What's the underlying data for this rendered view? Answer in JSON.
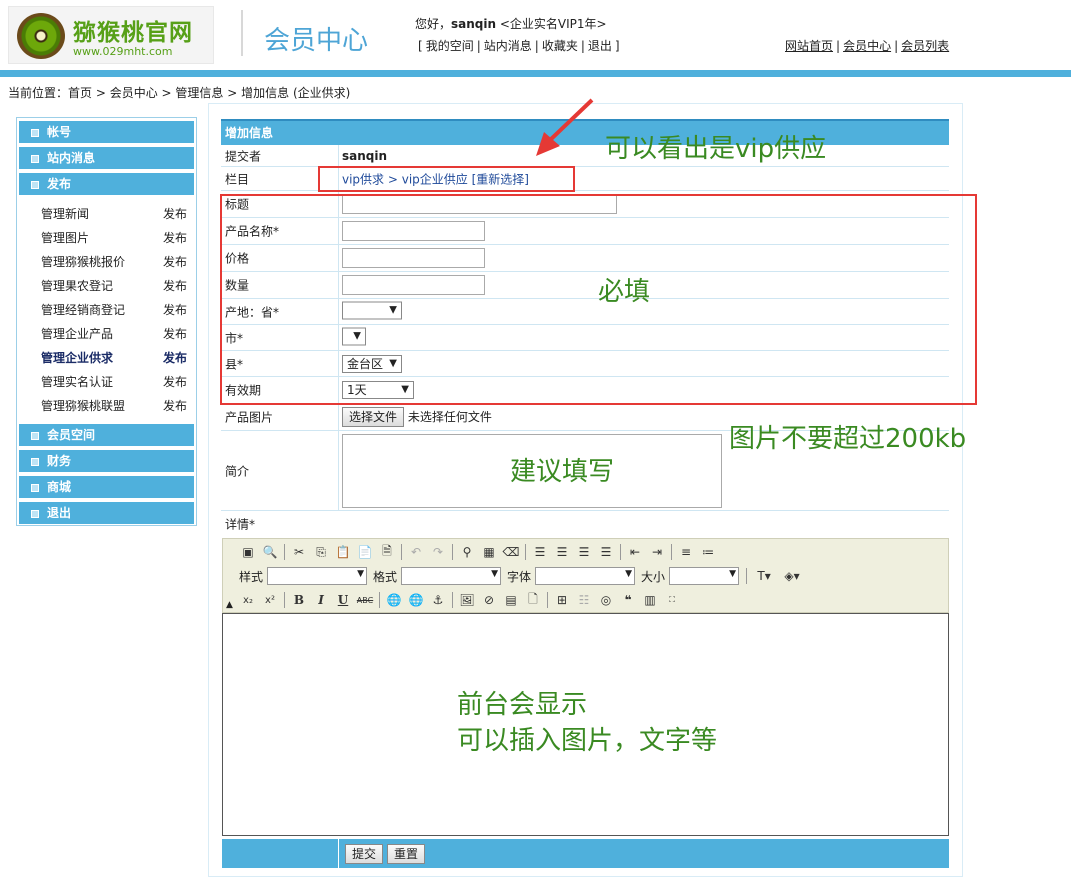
{
  "header": {
    "logo_title": "猕猴桃官网",
    "logo_url": "www.029mht.com",
    "center_title": "会员中心",
    "greeting_prefix": "您好，",
    "username": "sanqin",
    "member_level": "<企业实名VIP1年>",
    "quick_links": [
      "我的空间",
      "站内消息",
      "收藏夹",
      "退出"
    ],
    "site_links": [
      "网站首页",
      "会员中心",
      "会员列表"
    ]
  },
  "breadcrumb": {
    "prefix": "当前位置：",
    "items": [
      "首页",
      "会员中心",
      "管理信息",
      "增加信息 (企业供求)"
    ]
  },
  "sidebar": {
    "sections": [
      "帐号",
      "站内消息",
      "发布"
    ],
    "items": [
      {
        "label": "管理新闻",
        "action": "发布"
      },
      {
        "label": "管理图片",
        "action": "发布"
      },
      {
        "label": "管理猕猴桃报价",
        "action": "发布"
      },
      {
        "label": "管理果农登记",
        "action": "发布"
      },
      {
        "label": "管理经销商登记",
        "action": "发布"
      },
      {
        "label": "管理企业产品",
        "action": "发布"
      },
      {
        "label": "管理企业供求",
        "action": "发布"
      },
      {
        "label": "管理实名认证",
        "action": "发布"
      },
      {
        "label": "管理猕猴桃联盟",
        "action": "发布"
      }
    ],
    "sections_bottom": [
      "会员空间",
      "财务",
      "商城",
      "退出"
    ]
  },
  "form": {
    "heading": "增加信息",
    "submitter_label": "提交者",
    "submitter_value": "sanqin",
    "column_label": "栏目",
    "column_path": "vip供求 > vip企业供应",
    "reselect": "[重新选择]",
    "title_label": "标题",
    "product_name_label": "产品名称",
    "price_label": "价格",
    "quantity_label": "数量",
    "origin_label": "产地：省",
    "city_label": "市",
    "county_label": "县",
    "county_value": "金台区",
    "validity_label": "有效期",
    "validity_value": "1天",
    "image_label": "产品图片",
    "choose_file": "选择文件",
    "no_file": "未选择任何文件",
    "intro_label": "简介",
    "detail_label": "详情",
    "required_mark": "*",
    "submit": "提交",
    "reset": "重置"
  },
  "editor": {
    "style_label": "样式",
    "format_label": "格式",
    "font_label": "字体",
    "size_label": "大小"
  },
  "annotations": {
    "vip_note": "可以看出是vip供应",
    "required_note": "必填",
    "image_note": "图片不要超过200kb",
    "intro_note": "建议填写",
    "detail_note_1": "前台会显示",
    "detail_note_2": "可以插入图片，文字等"
  },
  "colors": {
    "accent": "#4fb0dc",
    "annotation_text": "#3a8a22",
    "annotation_box": "#e53935"
  }
}
